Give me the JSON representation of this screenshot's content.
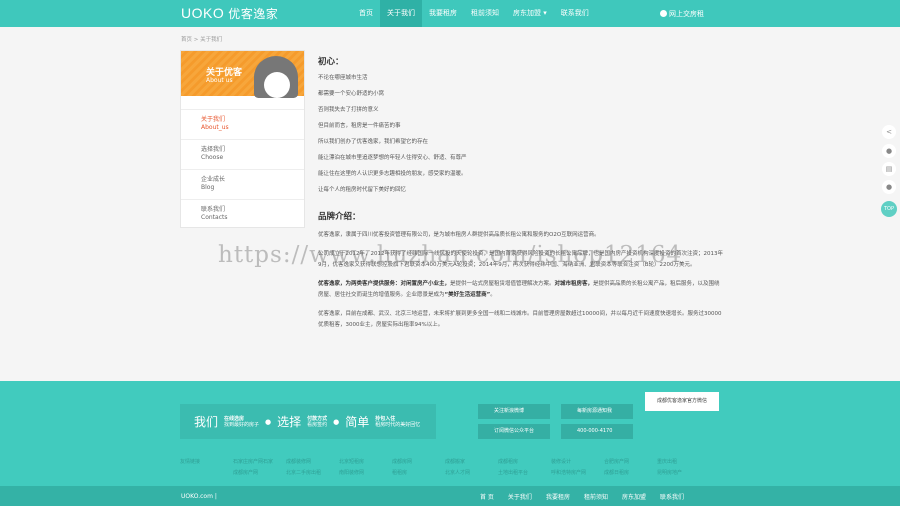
{
  "header": {
    "logo": "UOKO",
    "logo_cn": "优客逸家",
    "nav": [
      "首页",
      "关于我们",
      "我要租房",
      "租前须知",
      "房东加盟 ▾",
      "联系我们"
    ],
    "login": "网上交房租"
  },
  "breadcrumb": {
    "home": "首页",
    "sep": ">",
    "current": "关于我们"
  },
  "sidebar": {
    "banner_title": "关于优客",
    "banner_sub": "About us",
    "items": [
      {
        "cn": "关于我们",
        "en": "About_us"
      },
      {
        "cn": "选择我们",
        "en": "Choose"
      },
      {
        "cn": "企业成长",
        "en": "Blog"
      },
      {
        "cn": "联系我们",
        "en": "Contacts"
      }
    ]
  },
  "content": {
    "h1": "初心：",
    "lines": [
      "不论在哪座城市生活",
      "都需要一个安心舒适的小窝",
      "否则我失去了打拼的意义",
      "但目前而言，租房是一件痛苦的事",
      "所以我们创办了优客逸家，我们希望它的存在",
      "能让漂泊在城市里追逐梦想的年轻人住得安心、舒适、有尊严",
      "能让住在这里的人认识更多志趣相投的朋友，感受家的温暖。",
      "让每个人的租房时代留下美好的回忆"
    ],
    "h2": "品牌介绍：",
    "p1": "优客逸家，隶属于四川优客投资管理有限公司，是为城市租房人群提供高品质长租公寓和服务的O2O互联网运营商。",
    "p2": "公司成立于2012年，2012年获得了经纬国际一线风投的天使轮投资，是国内首家获得风险投资的长租公寓品牌，也是国内房产投资机构深度投资的首次注资；2013年9月，优客逸家又获得联想控股旗下君联资本400万美元A轮投资；2014年9月，再次获得经纬中国、海纳亚洲、君联资本等联合注资（B轮）2200万美元。",
    "p3_bold": "优客逸家，为两类客户提供服务：对闲置房产小业主，",
    "p3a": "是提供一站式房屋租赁增值管理解决方案。",
    "p3_bold2": "对城市租房客，",
    "p3b": "是提供高品质的长租公寓产品，租后服务，以及围绕房屋、居住社交而诞生的增值服务。企业愿景是成为",
    "p3_bold3": "“美好生活运营商”",
    "p3c": "。",
    "p4": "优客逸家，目前在成都、武汉、北京三地运营，未来将扩展到更多全国一线和二线城市。目前管理房屋数超过10000间，并以每月近千间速度快速增长。服务过30000优质租客，3000业主，房屋实际出租率94%以上。"
  },
  "watermark": "https://www.huzhan.com/ishop12164",
  "footer": {
    "slogan": [
      {
        "big": "我们",
        "t": "在线选房",
        "s": "找到最好的房子"
      },
      {
        "big": "选择",
        "t": "付款方式",
        "s": "看房签约"
      },
      {
        "big": "简单",
        "t": "拎包入住",
        "s": "租房时代的美好回忆"
      }
    ],
    "buttons": [
      "关注新浪微博",
      "每新房源通知我",
      "订阅微信公众平台",
      "400-000-4170"
    ],
    "qr": "成都优客逸家官方微信",
    "links": [
      "友情链接",
      "石家庄房产网石家",
      "成都装修网",
      "北京短租房",
      "成都房网",
      "成都搬家",
      "成都租房",
      "装修设计",
      "合肥房产网",
      "重庆出租",
      "",
      "成都房产网",
      "北京二手房出租",
      "南阳装修网",
      "租租房",
      "北京人才网",
      "土地出租平台",
      "呼和浩特房产网",
      "成都日租房",
      "昆明房地产"
    ],
    "copyright": "UOKO.com |",
    "bottom_nav": [
      "首 页",
      "关于我们",
      "我要租房",
      "租前须知",
      "房东加盟",
      "联系我们"
    ]
  },
  "float": [
    "share",
    "qq",
    "note",
    "wechat",
    "TOP"
  ]
}
